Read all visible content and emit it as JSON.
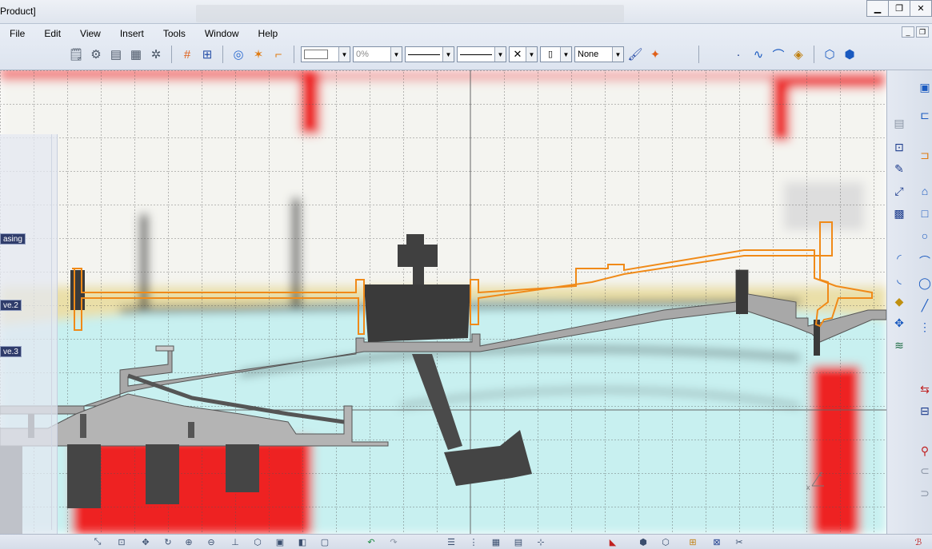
{
  "window": {
    "title": "Product]"
  },
  "menu": [
    "File",
    "Edit",
    "View",
    "Insert",
    "Tools",
    "Window",
    "Help"
  ],
  "toolbar": {
    "icons_group1": [
      "properties-icon",
      "parts-icon",
      "table-icon",
      "table-edit-icon",
      "gears-icon"
    ],
    "icons_group2": [
      "grid-icon",
      "snap-grid-icon"
    ],
    "icons_group3": [
      "analysis-icon",
      "constraint-icon",
      "dimension-icon"
    ],
    "line_thickness": "0%",
    "layer": "None",
    "icons_group4": [
      "paint-icon",
      "magic-icon"
    ],
    "icons_group5": [
      "point-icon",
      "curve-icon",
      "surface-icon",
      "sketch-icon"
    ]
  },
  "tree": {
    "nodes": [
      "asing",
      "ve.2",
      "ve.3"
    ]
  },
  "rightbar": {
    "icons": [
      "arc-icon",
      "corner-icon",
      "eraser-icon",
      "axis-icon",
      "constraint-tool-icon",
      "bolt-icon",
      "pencil-icon",
      "pattern-icon",
      "layer-icon"
    ]
  },
  "bottombar": {
    "icons": [
      "zoom-icon",
      "fit-icon",
      "pan-icon",
      "rotate-icon",
      "zoom-in-icon",
      "zoom-out-icon",
      "normal-view-icon",
      "iso-view-icon",
      "hide-icon",
      "shading-icon",
      "render-icon",
      "undo-icon",
      "redo-icon",
      "list-icon",
      "tree-icon",
      "grid-toggle-icon",
      "section-icon",
      "cube-icon",
      "measure-icon",
      "cut-icon"
    ]
  },
  "colors": {
    "orange_outline": "#f08a18",
    "dark_part": "#404040",
    "grey_part": "#9a9a9a",
    "cyan_fill": "#c8f0f0",
    "red_fill": "#ee2222",
    "grid": "#555555"
  },
  "axis": {
    "x_label": "x",
    "z_label": "z"
  }
}
